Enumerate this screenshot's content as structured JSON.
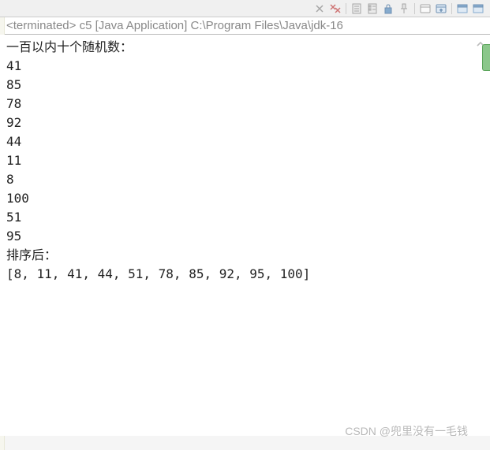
{
  "header": {
    "status": "<terminated>",
    "app_name": "c5",
    "app_type": "[Java Application]",
    "path": "C:\\Program Files\\Java\\jdk-16"
  },
  "console": {
    "title_line": "一百以内十个随机数：",
    "numbers": [
      "41",
      "85",
      "78",
      "92",
      "44",
      "11",
      "8",
      "100",
      "51",
      "95"
    ],
    "sorted_label": "排序后：",
    "sorted_array": "[8, 11, 41, 44, 51, 78, 85, 92, 95, 100]"
  },
  "toolbar": {
    "icons": {
      "remove_launch": "remove-launch",
      "remove_all": "remove-all",
      "clear": "clear",
      "scroll_lock": "scroll-lock",
      "pin": "pin",
      "console_out": "display-console",
      "console_switch": "open-console",
      "page1": "page-icon",
      "page2": "page-icon"
    }
  },
  "watermark": {
    "prefix": "CSDN",
    "author": "@兜里没有一毛钱"
  }
}
